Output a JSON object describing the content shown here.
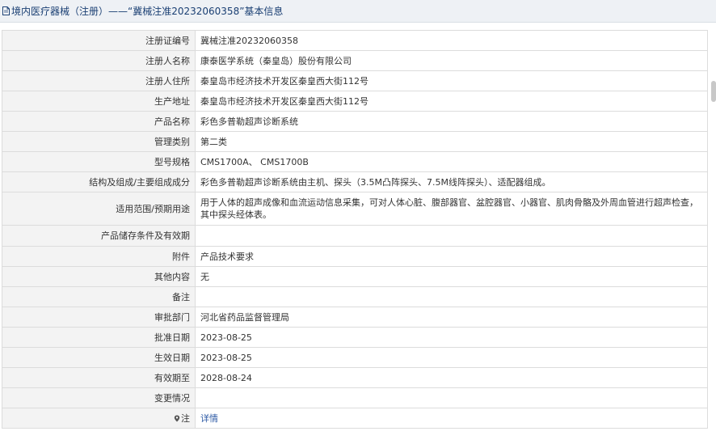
{
  "header": {
    "title": "境内医疗器械（注册）——“冀械注准20232060358”基本信息"
  },
  "rows": [
    {
      "label": "注册证编号",
      "value": "冀械注准20232060358"
    },
    {
      "label": "注册人名称",
      "value": "康泰医学系统（秦皇岛）股份有限公司"
    },
    {
      "label": "注册人住所",
      "value": "秦皇岛市经济技术开发区秦皇西大街112号"
    },
    {
      "label": "生产地址",
      "value": "秦皇岛市经济技术开发区秦皇西大街112号"
    },
    {
      "label": "产品名称",
      "value": "彩色多普勒超声诊断系统"
    },
    {
      "label": "管理类别",
      "value": "第二类"
    },
    {
      "label": "型号规格",
      "value": "CMS1700A、 CMS1700B"
    },
    {
      "label": "结构及组成/主要组成成分",
      "value": "彩色多普勒超声诊断系统由主机、探头（3.5M凸阵探头、7.5M线阵探头）、适配器组成。"
    },
    {
      "label": "适用范围/预期用途",
      "value": "用于人体的超声成像和血流运动信息采集，可对人体心脏、腹部器官、盆腔器官、小器官、肌肉骨骼及外周血管进行超声检查，其中探头经体表。"
    },
    {
      "label": "产品储存条件及有效期",
      "value": ""
    },
    {
      "label": "附件",
      "value": "产品技术要求"
    },
    {
      "label": "其他内容",
      "value": "无"
    },
    {
      "label": "备注",
      "value": ""
    },
    {
      "label": "审批部门",
      "value": "河北省药品监督管理局"
    },
    {
      "label": "批准日期",
      "value": "2023-08-25"
    },
    {
      "label": "生效日期",
      "value": "2023-08-25"
    },
    {
      "label": "有效期至",
      "value": "2028-08-24"
    },
    {
      "label": "变更情况",
      "value": ""
    }
  ],
  "note": {
    "label": "注",
    "link": "详情"
  },
  "colors": {
    "header_bg": "#eef1f5",
    "header_text": "#1a3f73",
    "label_bg": "#f3f3f3",
    "border": "#dcdcdc",
    "link": "#2d5aa5"
  }
}
